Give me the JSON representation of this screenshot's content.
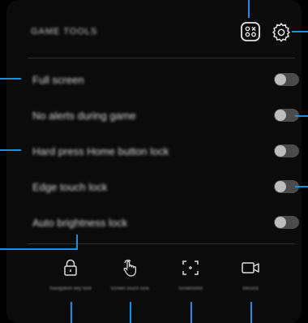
{
  "header": {
    "title": "GAME TOOLS"
  },
  "settings_rows": [
    {
      "label": "Full screen",
      "enabled": false
    },
    {
      "label": "No alerts during game",
      "enabled": false
    },
    {
      "label": "Hard press Home button lock",
      "enabled": false
    },
    {
      "label": "Edge touch lock",
      "enabled": false
    },
    {
      "label": "Auto brightness lock",
      "enabled": false
    }
  ],
  "bottom_tools": [
    {
      "label": "Navigation key lock",
      "icon": "lock-icon"
    },
    {
      "label": "Screen touch lock",
      "icon": "touch-icon"
    },
    {
      "label": "Screenshot",
      "icon": "screenshot-icon"
    },
    {
      "label": "Record",
      "icon": "record-icon"
    }
  ],
  "colors": {
    "background": "#000000",
    "panel": "#0b0b0b",
    "callout": "#1e8fe0",
    "toggle_off": "#4b4b4b"
  }
}
